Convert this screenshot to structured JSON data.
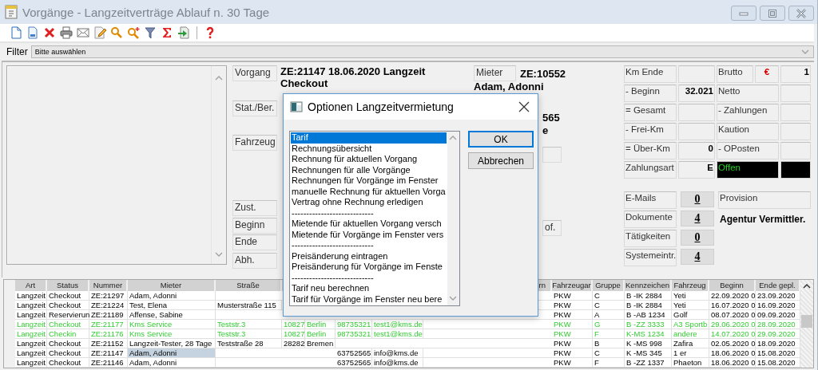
{
  "window": {
    "title": "Vorgänge - Langzeitverträge Ablauf n. 30 Tage"
  },
  "filter": {
    "label": "Filter",
    "value": "Bitte auswählen"
  },
  "details": {
    "fields": [
      {
        "label": "Vorgang",
        "value": "ZE:21147 18.06.2020 Langzeit Checkout"
      },
      {
        "label": "Stat./Ber."
      },
      {
        "label": "Fahrzeug"
      },
      {
        "label": "Zust."
      },
      {
        "label": "Beginn"
      },
      {
        "label": "Ende"
      },
      {
        "label": "Abh."
      }
    ],
    "mieter": {
      "label": "Mieter",
      "number": "ZE:10552",
      "name": "Adam, Adonni",
      "line_3": "565",
      "line_4": "e",
      "box_2": "of."
    },
    "km": [
      {
        "label": "Km Ende"
      },
      {
        "label": "- Beginn",
        "value": "32.021"
      },
      {
        "label": "= Gesamt"
      },
      {
        "label": "- Frei-Km"
      },
      {
        "label": "= Über-Km",
        "value": "0"
      },
      {
        "label": "Zahlungsart",
        "value": "E"
      }
    ],
    "amounts": [
      {
        "kind": "currency",
        "label": "Brutto",
        "currency": "€",
        "value": "1"
      },
      {
        "kind": "plain",
        "label": "Netto"
      },
      {
        "kind": "plain",
        "label": "- Zahlungen"
      },
      {
        "kind": "plain",
        "label": "Kaution"
      },
      {
        "kind": "plain",
        "label": "- OPosten"
      },
      {
        "kind": "status",
        "label": "Offen"
      }
    ],
    "counts": [
      {
        "label": "E-Mails",
        "value": "0"
      },
      {
        "label": "Dokumente",
        "value": "4"
      },
      {
        "label": "Tätigkeiten",
        "value": "0"
      },
      {
        "label": "Systemeintr.",
        "value": "4"
      }
    ],
    "provision": {
      "label": "Provision",
      "value": "Agentur Vermittler."
    }
  },
  "table": {
    "columns": [
      "Art",
      "Status",
      "Nummer",
      "Mieter",
      "Straße",
      null,
      null,
      null,
      null,
      "rn",
      "Fahrzeugar",
      "Gruppe",
      "Kennzeichen",
      "Fahrzeug",
      "Beginn",
      "Ende gepl."
    ],
    "rows": [
      {
        "kind": "plain",
        "selected": false,
        "cells": [
          "Langzeit",
          "Checkout",
          "ZE:21297",
          "Adam, Adonni",
          null,
          null,
          null,
          null,
          null,
          null,
          "PKW",
          "C",
          "B -IK 2884",
          "Yeti",
          "22.09.2020 0",
          "23.09.2020"
        ]
      },
      {
        "kind": "plain",
        "selected": false,
        "cells": [
          "Langzeit",
          "Checkout",
          "ZE:21224",
          "Test, Elena",
          "Musterstraße 115",
          null,
          null,
          null,
          null,
          null,
          "PKW",
          "C",
          "B -IK 2884",
          "Yeti",
          "16.07.2020 0",
          "16.09.2020"
        ]
      },
      {
        "kind": "plain",
        "selected": false,
        "cells": [
          "Langzeit",
          "Reservierun",
          "ZE:21189",
          "Affense, Sabine",
          null,
          null,
          null,
          null,
          null,
          null,
          "PKW",
          "A",
          "B -AB 1234",
          "Golf",
          "08.07.2020 0",
          "09.09.2020"
        ]
      },
      {
        "kind": "marked",
        "selected": false,
        "cells": [
          "Langzeit",
          "Checkout",
          "ZE:21177",
          "Kms Service",
          "Teststr.3",
          "10827",
          "Berlin",
          "98735321",
          "test1@kms.de",
          null,
          "PKW",
          "G",
          "B -ZZ 3333",
          "A3 Sportb",
          "29.06.2020 0",
          "28.09.2020"
        ]
      },
      {
        "kind": "marked",
        "selected": false,
        "cells": [
          "Langzeit",
          "Checkin",
          "ZE:21176",
          "Kms Service",
          "Teststr.3",
          "10827",
          "Berlin",
          "98735321",
          "test1@kms.de",
          null,
          "PKW",
          "F",
          "K-MS 1234",
          "andere",
          "14.07.2020 0",
          "29.09.2020"
        ]
      },
      {
        "kind": "plain",
        "selected": false,
        "cells": [
          "Langzeit",
          "Checkout",
          "ZE:21152",
          "Langzeit-Tester, 28 Tage",
          "Teststraße 28",
          "28282",
          "Bremen",
          null,
          null,
          null,
          "PKW",
          "B",
          "K -MS 998",
          "Zafira",
          "02.05.2020 0",
          "18.09.2020"
        ]
      },
      {
        "kind": "plain",
        "selected": true,
        "cells": [
          "Langzeit",
          "Checkout",
          "ZE:21147",
          "Adam, Adonni",
          null,
          null,
          null,
          "63752565",
          "info@kms.de",
          null,
          "PKW",
          "C",
          "K -MS 345",
          "1 er",
          "18.06.2020 0",
          "15.08.2020"
        ]
      },
      {
        "kind": "plain",
        "selected": false,
        "cells": [
          "Langzeit",
          "Checkout",
          "ZE:21146",
          "Adam, Adonni",
          null,
          null,
          null,
          "63752565",
          "info@kms.de",
          null,
          "PKW",
          "F",
          "B -ZZ 1337",
          "Phaeton",
          "18.06.2020 0",
          "15.08.2020"
        ]
      }
    ]
  },
  "dialog": {
    "title": "Optionen Langzeitvermietung",
    "options": [
      {
        "label": "Tarif",
        "selected": true
      },
      {
        "label": "Rechnungsübersicht",
        "selected": false
      },
      {
        "label": "Rechnung für aktuellen Vorgang",
        "selected": false
      },
      {
        "label": "Rechnungen für alle Vorgänge",
        "selected": false
      },
      {
        "label": "Rechnungen für Vorgänge im Fenster",
        "selected": false
      },
      {
        "label": "manuelle Rechnung für aktuellen Vorga",
        "selected": false
      },
      {
        "label": "Vertrag ohne Rechnung erledigen",
        "selected": false
      },
      {
        "label": "----------------------------",
        "selected": false
      },
      {
        "label": "Mietende für aktuellen Vorgang versch",
        "selected": false
      },
      {
        "label": "Mietende für Vorgänge im Fenster vers",
        "selected": false
      },
      {
        "label": "----------------------------",
        "selected": false
      },
      {
        "label": "Preisänderung eintragen",
        "selected": false
      },
      {
        "label": "Preisänderung für Vorgänge im Fenste",
        "selected": false
      },
      {
        "label": "----------------------------",
        "selected": false
      },
      {
        "label": "Tarif neu berechnen",
        "selected": false
      },
      {
        "label": "Tarif für Vorgänge im Fenster neu bere",
        "selected": false
      }
    ],
    "buttons": [
      {
        "label": "OK",
        "focused": true
      },
      {
        "label": "Abbrechen",
        "focused": false
      }
    ]
  }
}
